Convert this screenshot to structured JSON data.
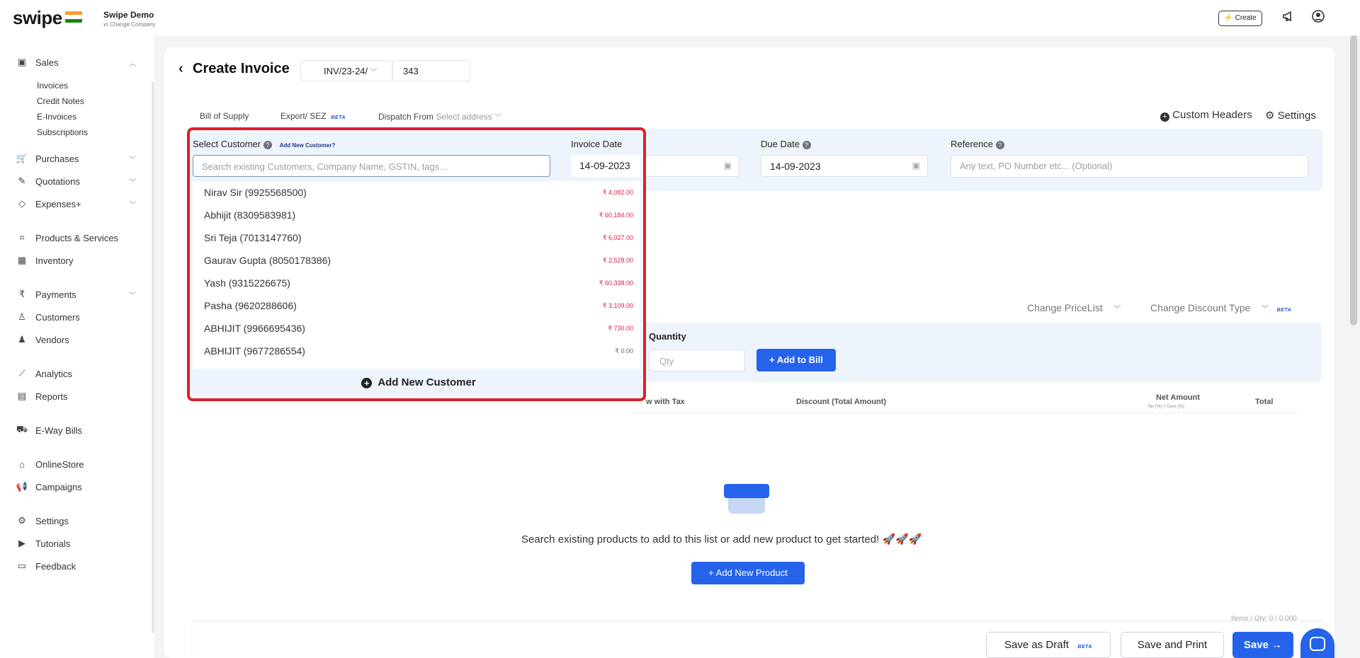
{
  "topbar": {
    "logo": "swipe",
    "company_name": "Swipe Demo",
    "company_sub": "Change Company",
    "create_label": "Create",
    "create_prefix": "⚡"
  },
  "sidebar": {
    "sales": "Sales",
    "sub_items": [
      "Invoices",
      "Credit Notes",
      "E-Invoices",
      "Subscriptions"
    ],
    "purchases": "Purchases",
    "quotations": "Quotations",
    "expenses": "Expenses+",
    "products": "Products & Services",
    "inventory": "Inventory",
    "payments": "Payments",
    "customers": "Customers",
    "vendors": "Vendors",
    "analytics": "Analytics",
    "reports": "Reports",
    "eway": "E-Way Bills",
    "onlinestore": "OnlineStore",
    "campaigns": "Campaigns",
    "settings": "Settings",
    "tutorials": "Tutorials",
    "feedback": "Feedback"
  },
  "header": {
    "title": "Create Invoice",
    "inv_prefix": "INV/23-24/",
    "inv_number": "343",
    "bill_of_supply": "Bill of Supply",
    "export_sez": "Export/ SEZ",
    "beta": "BETA",
    "dispatch_from": "Dispatch From",
    "select_address": "Select address",
    "custom_headers": "Custom Headers",
    "settings": "Settings"
  },
  "form": {
    "invoice_date_label": "Invoice Date",
    "invoice_date": "14-09-2023",
    "due_date_label": "Due Date",
    "due_date": "14-09-2023",
    "reference_label": "Reference",
    "reference_placeholder": "Any text, PO Number etc... (Optional)"
  },
  "products": {
    "change_pricelist": "Change PriceList",
    "change_discount": "Change Discount Type",
    "beta": "BETA",
    "quantity_label": "Quantity",
    "qty_placeholder": "Qty",
    "add_to_bill": "+ Add to Bill",
    "col_price_with_tax": "w with Tax",
    "col_discount": "Discount (Total Amount)",
    "col_net_amount": "Net Amount",
    "col_net_sub": "Tax (%) + Cess (%)",
    "col_total": "Total",
    "empty_text": "Search existing products to add to this list or add new product to get started! 🚀🚀🚀",
    "add_new_product": "+ Add New Product",
    "items_count": "Items / Qty: 0 / 0.000"
  },
  "footer": {
    "save_draft": "Save as Draft",
    "beta": "BETA",
    "save_print": "Save and Print",
    "save": "Save →"
  },
  "dropdown": {
    "label": "Select Customer",
    "add_new_link": "Add New Customer?",
    "search_placeholder": "Search existing Customers, Company Name, GSTIN, tags...",
    "customers": [
      {
        "name": "Nirav Sir (9925568500)",
        "amount": "₹ 4,082.00"
      },
      {
        "name": "Abhijit (8309583981)",
        "amount": "₹ 60,184.00"
      },
      {
        "name": "Sri Teja (7013147760)",
        "amount": "₹ 6,027.00"
      },
      {
        "name": "Gaurav Gupta (8050178386)",
        "amount": "₹ 2,528.00"
      },
      {
        "name": "Yash (9315226675)",
        "amount": "₹ 60,338.00"
      },
      {
        "name": "Pasha (9620288606)",
        "amount": "₹ 3,109.00"
      },
      {
        "name": "ABHIJIT (9966695436)",
        "amount": "₹ 730.00"
      },
      {
        "name": "ABHIJIT (9677286554)",
        "amount": "₹ 0.00"
      }
    ],
    "add_new_customer": "Add New Customer"
  }
}
